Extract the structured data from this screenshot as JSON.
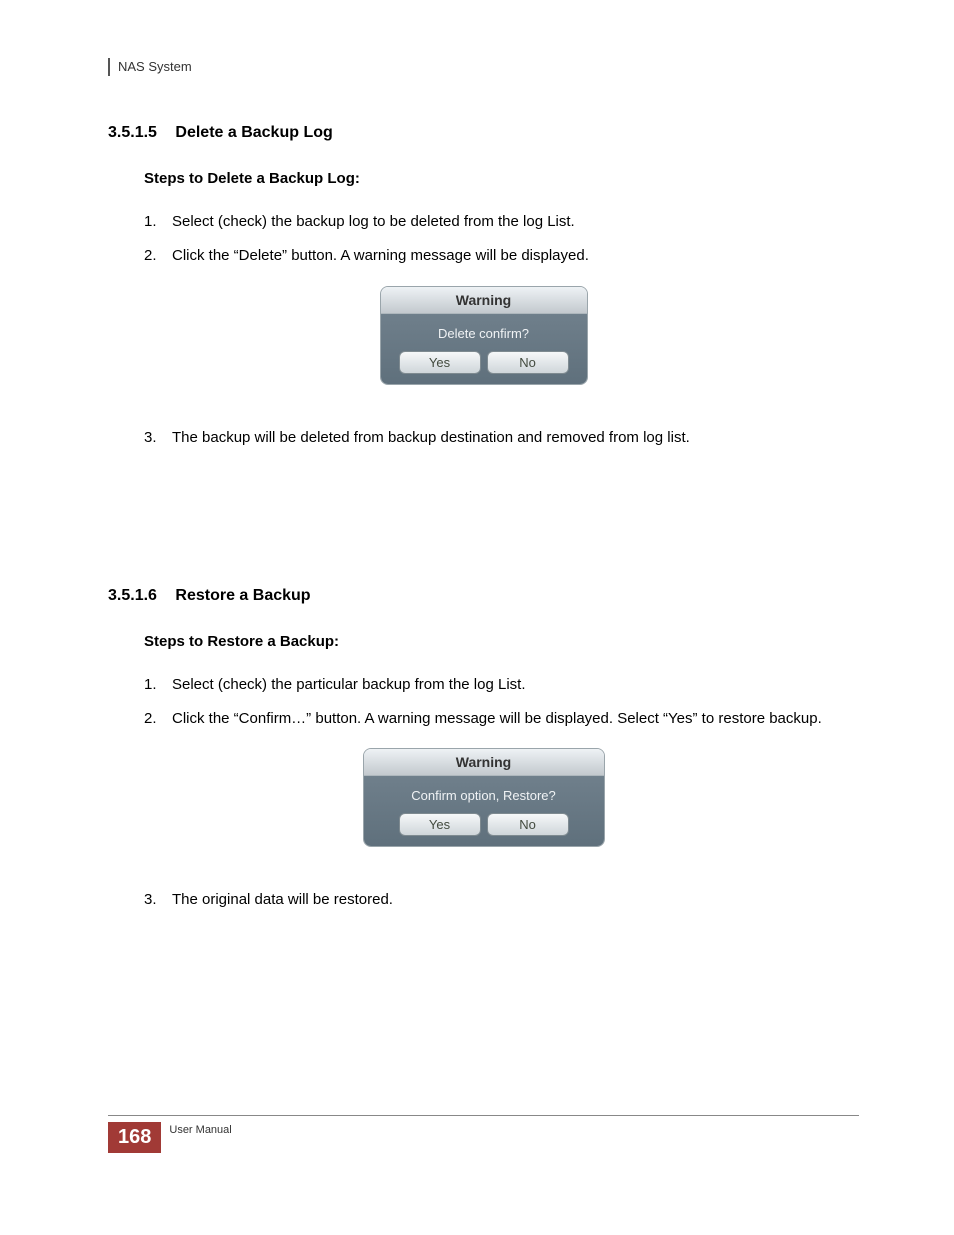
{
  "header": {
    "title": "NAS System"
  },
  "section1": {
    "number": "3.5.1.5",
    "title": "Delete a Backup Log",
    "subheading": "Steps to Delete a Backup Log:",
    "step1": "Select (check) the backup log to be deleted from the log List.",
    "step2": "Click the “Delete” button. A warning message will be displayed.",
    "step3": "The backup will be deleted from backup destination and removed from log list."
  },
  "dialog1": {
    "title": "Warning",
    "message": "Delete confirm?",
    "yes": "Yes",
    "no": "No"
  },
  "section2": {
    "number": "3.5.1.6",
    "title": "Restore a Backup",
    "subheading": "Steps to Restore a Backup:",
    "step1": "Select (check) the particular backup from the log List.",
    "step2": "Click the “Confirm…” button. A warning message will be displayed. Select “Yes” to restore backup.",
    "step3": "The original data will be restored."
  },
  "dialog2": {
    "title": "Warning",
    "message": "Confirm option, Restore?",
    "yes": "Yes",
    "no": "No"
  },
  "footer": {
    "page_number": "168",
    "label": "User Manual"
  },
  "markers": {
    "m1": "1.",
    "m2": "2.",
    "m3": "3."
  }
}
